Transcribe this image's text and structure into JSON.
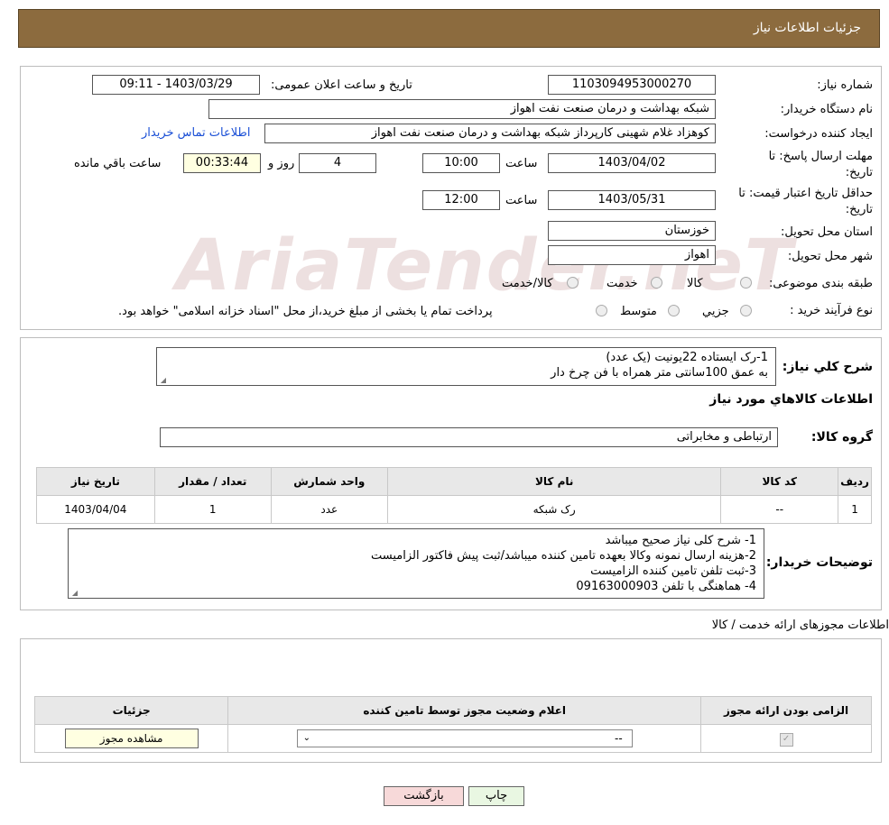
{
  "header": {
    "title": "جزئیات اطلاعات نیاز"
  },
  "details": {
    "need_number_label": "شماره نیاز:",
    "need_number": "1103094953000270",
    "announce_label": "تاریخ و ساعت اعلان عمومی:",
    "announce_value": "1403/03/29 - 09:11",
    "buyer_org_label": "نام دستگاه خریدار:",
    "buyer_org": "شبکه بهداشت و درمان صنعت نفت اهواز",
    "creator_label": "ایجاد کننده درخواست:",
    "creator": "کوهزاد غلام شهینی کارپرداز شبکه بهداشت و درمان صنعت نفت اهواز",
    "buyer_contact_link": "اطلاعات تماس خریدار",
    "reply_deadline_label": "مهلت ارسال پاسخ: تا تاریخ:",
    "reply_date": "1403/04/02",
    "time_label": "ساعت",
    "reply_time": "10:00",
    "days_value": "4",
    "day_and_label": "روز و",
    "remaining_time": "00:33:44",
    "remaining_label": "ساعت باقي مانده",
    "price_validity_label": "حداقل تاريخ اعتبار قيمت: تا تاريخ:",
    "price_date": "1403/05/31",
    "price_time": "12:00",
    "province_label": "استان محل تحویل:",
    "province": "خوزستان",
    "city_label": "شهر محل تحویل:",
    "city": "اهواز",
    "category_label": "طبقه بندی موضوعی:",
    "category_options": [
      "کالا",
      "خدمت",
      "کالا/خدمت"
    ],
    "purchase_type_label": "نوع فرآیند خرید :",
    "purchase_options": [
      "جزيي",
      "متوسط"
    ],
    "purchase_note": "پرداخت تمام یا بخشی از مبلغ خرید،از محل \"اسناد خزانه اسلامی\" خواهد بود."
  },
  "description": {
    "label": "شرح کلي نياز:",
    "lines": [
      "1-رک ایستاده 22یونیت (یک عدد)",
      "به عمق 100سانتی متر همراه با فن چرخ دار"
    ],
    "goods_info_title": "اطلاعات کالاهاي مورد نياز",
    "goods_group_label": "گروه کالا:",
    "goods_group": "ارتباطی و مخابراتی"
  },
  "goods_table": {
    "headers": [
      "رديف",
      "کد کالا",
      "نام کالا",
      "واحد شمارش",
      "تعداد / مقدار",
      "تاريخ نياز"
    ],
    "rows": [
      [
        "1",
        "--",
        "رک شبکه",
        "عدد",
        "1",
        "1403/04/04"
      ]
    ]
  },
  "buyer_notes": {
    "label": "توضیحات خریدار:",
    "lines": [
      "1- شرح کلی نیاز صحیح میباشد",
      "2-هزینه ارسال نمونه وکالا بعهده تامین کننده میباشد/ثبت پیش فاکتور الزامیست",
      "3-ثبت تلفن تامین کننده الزامیست",
      "4- هماهنگی با تلفن 09163000903"
    ]
  },
  "permits": {
    "title": "اطلاعات مجوزهای ارائه خدمت / کالا",
    "headers": [
      "الزامی بودن ارائه مجوز",
      "اعلام وضعیت مجوز توسط تامین کننده",
      "جزئیات"
    ],
    "select_value": "--",
    "view_button": "مشاهده مجوز"
  },
  "buttons": {
    "print": "چاپ",
    "back": "بازگشت"
  },
  "watermark": "AriaTender.neT",
  "colors": {
    "header_bg": "#8c6b3e",
    "link": "#1a4fd6",
    "back_btn": "#f7d9d9",
    "print_btn": "#e9f7e2",
    "remaining_bg": "#ffffe1"
  }
}
